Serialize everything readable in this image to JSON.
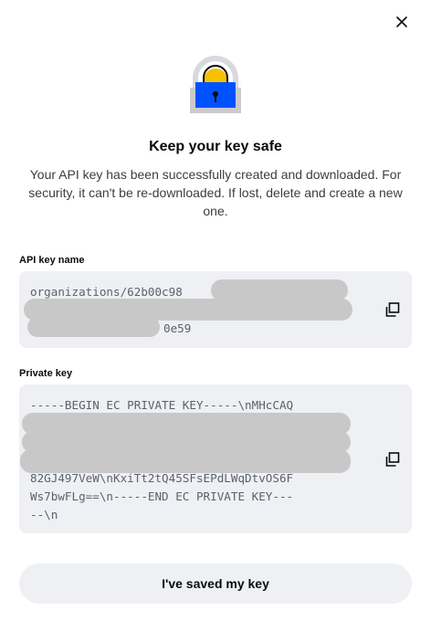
{
  "dialog": {
    "title": "Keep your key safe",
    "subtitle": "Your API key has been successfully created and downloaded. For security, it can't be re-downloaded. If lost, delete and create a new one."
  },
  "api_key": {
    "label": "API key name",
    "line1": "organizations/62b00c98",
    "line3_suffix": "0e59"
  },
  "private_key": {
    "label": "Private key",
    "line1": "-----BEGIN EC PRIVATE KEY-----\\nMHcCAQ",
    "line5": "82GJ497VeW\\nKxiTt2tQ45SFsEPdLWqDtvOS6F",
    "line6": "Ws7bwFLg==\\n-----END EC PRIVATE KEY---",
    "line7": "--\\n"
  },
  "actions": {
    "confirm_label": "I've saved my key"
  },
  "icons": {
    "close": "close-icon",
    "hero": "padlock-icon",
    "copy": "copy-icon"
  },
  "colors": {
    "accent": "#0052ff",
    "lock_shackle": "#f8c100",
    "field_bg": "#eef0f3",
    "redaction": "#c8c8c8"
  }
}
